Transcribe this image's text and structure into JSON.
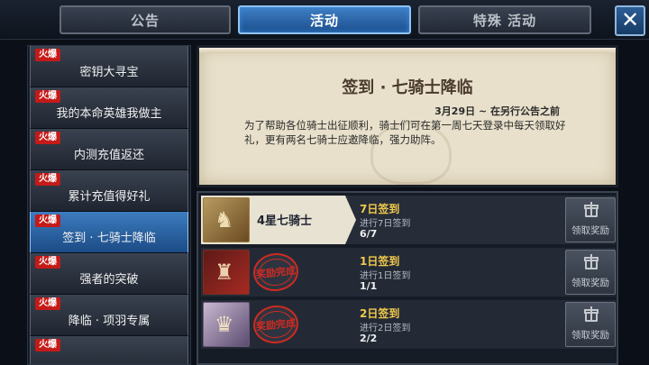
{
  "tabs": [
    {
      "label": "公告"
    },
    {
      "label": "活动"
    },
    {
      "label": "特殊 活动"
    }
  ],
  "close_label": "✕",
  "events": {
    "hot_label": "火爆",
    "items": [
      {
        "label": "密钥大寻宝"
      },
      {
        "label": "我的本命英雄我做主"
      },
      {
        "label": "内测充值返还"
      },
      {
        "label": "累计充值得好礼"
      },
      {
        "label": "签到 · 七骑士降临"
      },
      {
        "label": "强者的突破"
      },
      {
        "label": "降临 · 项羽专属"
      },
      {
        "label": ""
      }
    ]
  },
  "description": {
    "title": "签到 · 七骑士降临",
    "date": "3月29日 ~ 在另行公告之前",
    "body": "为了帮助各位骑士出征顺利，骑士们可在第一周七天登录中每天领取好礼，更有两名七骑士应邀降临，强力助阵。"
  },
  "rewards": [
    {
      "hero_label": "4星七骑士",
      "title": "7日签到",
      "desc": "进行7日签到",
      "progress": "6/7",
      "claim_label": "领取奖励"
    },
    {
      "stamp_label": "奖励完成",
      "title": "1日签到",
      "desc": "进行1日签到",
      "progress": "1/1",
      "claim_label": "领取奖励"
    },
    {
      "stamp_label": "奖励完成",
      "title": "2日签到",
      "desc": "进行2日签到",
      "progress": "2/2",
      "claim_label": "领取奖励"
    }
  ],
  "colors": {
    "accent_blue": "#3d7cc0",
    "hot_red": "#c41a18",
    "reward_gold": "#f2c94c",
    "stamp_red": "#d02a22"
  }
}
